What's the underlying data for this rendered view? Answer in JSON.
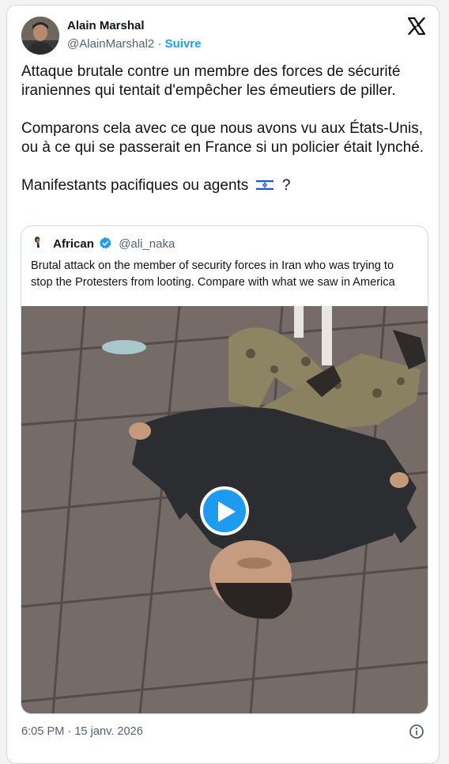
{
  "author": {
    "name": "Alain Marshal",
    "handle": "@AlainMarshal2",
    "separator": "·",
    "follow_label": "Suivre"
  },
  "tweet": {
    "paragraphs": [
      "Attaque brutale contre un membre des forces de sécurité iraniennes qui tentait d'empêcher les émeutiers de piller.",
      "Comparons cela avec ce que nous avons vu aux États-Unis, ou à ce qui se passerait en France si un policier était lynché."
    ],
    "last_line_start": "Manifestants pacifiques ou agents",
    "last_line_end": "?"
  },
  "quoted_tweet": {
    "name": "African",
    "handle": "@ali_naka",
    "text": "Brutal attack on the member of security forces in Iran who was trying to stop the Protesters from looting. Compare with what we saw in America"
  },
  "footer": {
    "timestamp": "6:05 PM · 15 janv. 2026"
  },
  "icons": {
    "platform": "x-logo-icon",
    "verified": "verified-badge-icon",
    "flag": "israel-flag-icon",
    "play": "play-icon",
    "info": "info-icon"
  },
  "colors": {
    "accent": "#1d9bf0",
    "text": "#0f1419",
    "secondary_text": "#536471",
    "border": "#cfd9de"
  }
}
